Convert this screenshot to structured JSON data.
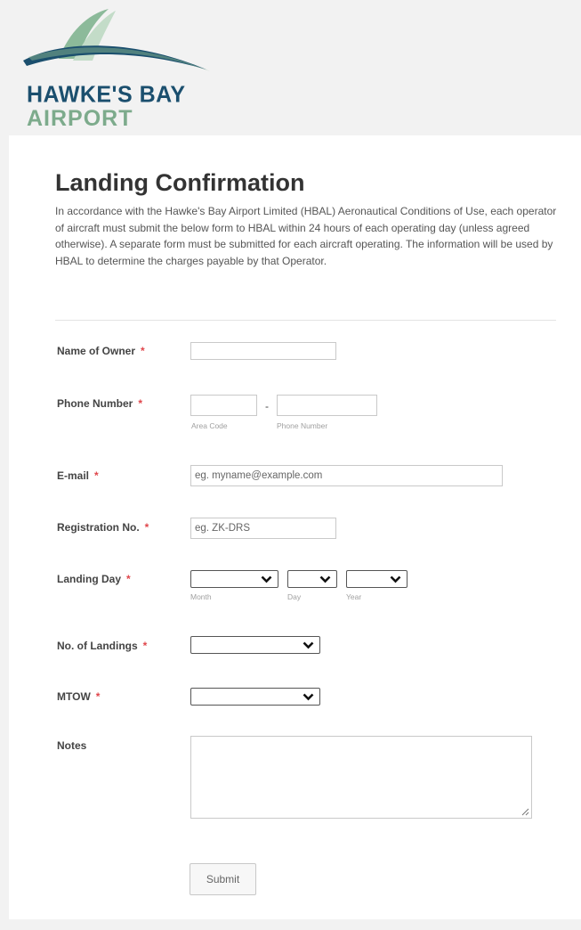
{
  "logo": {
    "line1": "HAWKE'S BAY",
    "line2": "AIRPORT",
    "colors": {
      "navy": "#1b4f6e",
      "green": "#7dab8c"
    }
  },
  "form": {
    "title": "Landing Confirmation",
    "intro": "In accordance with the Hawke's Bay Airport Limited (HBAL) Aeronautical Conditions of Use, each operator of aircraft must submit the below form to HBAL within 24 hours of each operating day (unless agreed otherwise). A separate form must be submitted for each aircraft operating. The information will be used by HBAL to determine the charges payable by that Operator.",
    "required_marker": "*",
    "fields": {
      "owner": {
        "label": "Name of Owner",
        "value": ""
      },
      "phone": {
        "label": "Phone Number",
        "area_sub": "Area Code",
        "number_sub": "Phone Number",
        "separator": "-"
      },
      "email": {
        "label": "E-mail",
        "placeholder": "eg. myname@example.com"
      },
      "registration": {
        "label": "Registration No.",
        "placeholder": "eg. ZK-DRS"
      },
      "landing_day": {
        "label": "Landing Day",
        "month_sub": "Month",
        "day_sub": "Day",
        "year_sub": "Year"
      },
      "landings": {
        "label": "No. of Landings"
      },
      "mtow": {
        "label": "MTOW"
      },
      "notes": {
        "label": "Notes"
      }
    },
    "submit_label": "Submit",
    "required_color": "#e0464b"
  }
}
